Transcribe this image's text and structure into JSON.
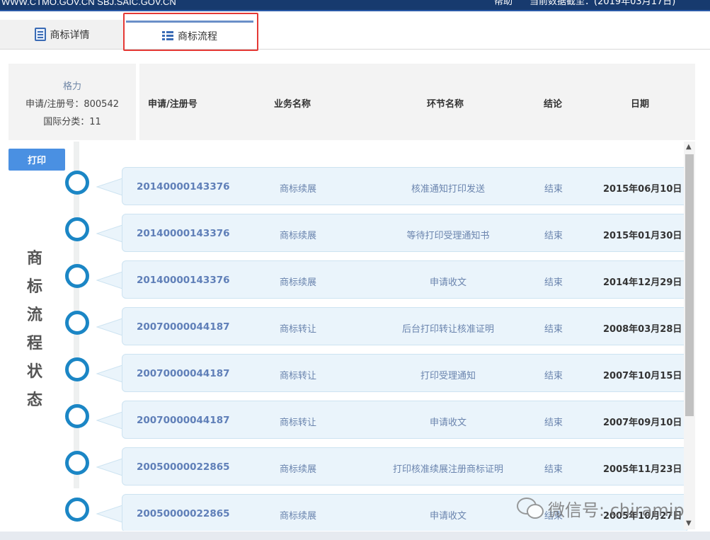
{
  "topbar": {
    "site": "WWW.CTMO.GOV.CN SBJ.SAIC.GOV.CN",
    "help": "帮助",
    "as_of": "当前数据截至：(2019年03月17日)"
  },
  "tabs": [
    {
      "label": "商标详情",
      "icon": "document-icon",
      "active": false
    },
    {
      "label": "商标流程",
      "icon": "list-icon",
      "active": true
    }
  ],
  "info": {
    "brand": "格力",
    "reg_no": "申请/注册号：800542",
    "intl_class": "国际分类：11"
  },
  "print_label": "打印",
  "side_title": [
    "商",
    "标",
    "流",
    "程",
    "状",
    "态"
  ],
  "columns": {
    "no": "申请/注册号",
    "biz": "业务名称",
    "step": "环节名称",
    "result": "结论",
    "date": "日期"
  },
  "rows": [
    {
      "no": "20140000143376",
      "biz": "商标续展",
      "step": "核准通知打印发送",
      "result": "结束",
      "date": "2015年06月10日"
    },
    {
      "no": "20140000143376",
      "biz": "商标续展",
      "step": "等待打印受理通知书",
      "result": "结束",
      "date": "2015年01月30日"
    },
    {
      "no": "20140000143376",
      "biz": "商标续展",
      "step": "申请收文",
      "result": "结束",
      "date": "2014年12月29日"
    },
    {
      "no": "20070000044187",
      "biz": "商标转让",
      "step": "后台打印转让核准证明",
      "result": "结束",
      "date": "2008年03月28日"
    },
    {
      "no": "20070000044187",
      "biz": "商标转让",
      "step": "打印受理通知",
      "result": "结束",
      "date": "2007年10月15日"
    },
    {
      "no": "20070000044187",
      "biz": "商标转让",
      "step": "申请收文",
      "result": "结束",
      "date": "2007年09月10日"
    },
    {
      "no": "20050000022865",
      "biz": "商标续展",
      "step": "打印核准续展注册商标证明",
      "result": "结束",
      "date": "2005年11月23日"
    },
    {
      "no": "20050000022865",
      "biz": "商标续展",
      "step": "申请收文",
      "result": "结束",
      "date": "2005年10月27日"
    }
  ],
  "watermark": "微信号: chiramip",
  "colors": {
    "accent": "#1b86c5",
    "button": "#4a90e2",
    "banner": "#173a6e",
    "highlight": "#e53935"
  }
}
